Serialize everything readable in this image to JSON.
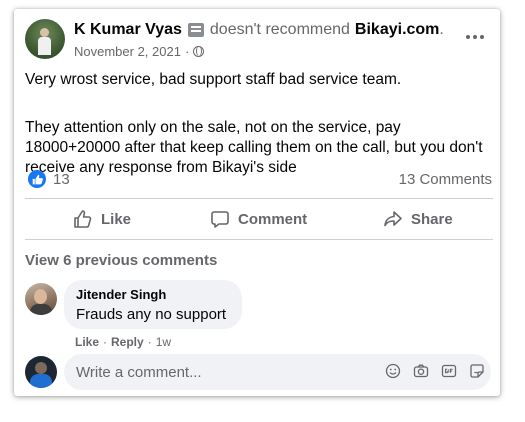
{
  "post": {
    "author": "K Kumar Vyas",
    "recommend_text": "doesn't recommend",
    "business": "Bikayi.com",
    "trailing": ".",
    "date": "November 2, 2021",
    "dot": "·",
    "paragraphs": [
      "Very wrost service, bad support staff bad service team.",
      "They attention only on the sale, not on the service, pay 18000+20000 after that keep calling them on the call, but you don't receive any response from Bikayi's side"
    ]
  },
  "reactions": {
    "count": "13",
    "comments": "13 Comments"
  },
  "actions": {
    "like": "Like",
    "comment": "Comment",
    "share": "Share"
  },
  "view_previous": "View 6 previous comments",
  "comment": {
    "name": "Jitender Singh",
    "text": "Frauds any no support",
    "like": "Like",
    "reply": "Reply",
    "sep": "·",
    "time": "1w"
  },
  "composer": {
    "placeholder": "Write a comment..."
  },
  "colors": {
    "accent": "#1877f2",
    "muted": "#65676b",
    "bubble": "#f0f2f5"
  },
  "icons": [
    "recommend-icon",
    "globe-icon",
    "more-icon",
    "like-icon",
    "comment-icon",
    "share-icon",
    "emoji-icon",
    "camera-icon",
    "gif-icon",
    "sticker-icon"
  ]
}
